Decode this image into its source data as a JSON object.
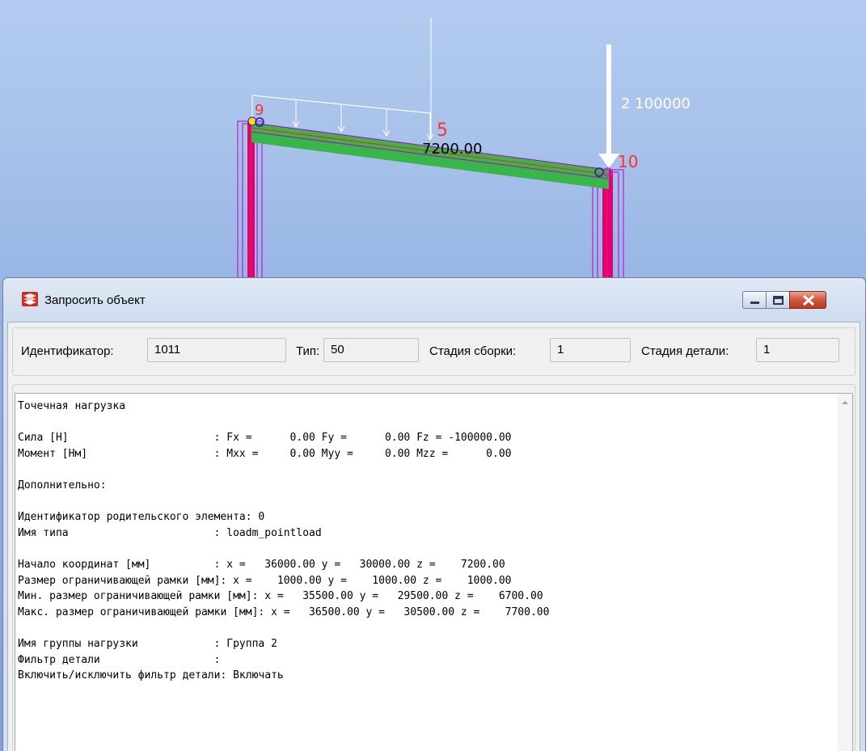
{
  "viewport": {
    "labels": {
      "node_9": "9",
      "node_5": "5",
      "node_10": "10",
      "dimension": "7200.00",
      "load": "2  100000"
    },
    "colors": {
      "background_top": "#b3cbef",
      "background_bottom": "#7f9fd8",
      "beam": "#3ab54a",
      "column": "#e0007a",
      "outline": "#b800d0",
      "load_arrow": "#ffffff",
      "label_red": "#ff3030"
    }
  },
  "dialog": {
    "title": "Запросить объект",
    "icon": "tekla-app-icon",
    "window_buttons": {
      "minimize": "minimize-icon",
      "maximize": "maximize-icon",
      "close": "close-icon"
    },
    "fields": {
      "id_label": "Идентификатор:",
      "id_value": "1011",
      "type_label": "Тип:",
      "type_value": "50",
      "assembly_stage_label": "Стадия сборки:",
      "assembly_stage_value": "1",
      "part_stage_label": "Стадия детали:",
      "part_stage_value": "1"
    },
    "report": "Точечная нагрузка\n\nСила [Н]                       : Fx =      0.00 Fy =      0.00 Fz = -100000.00\nМомент [Нм]                    : Mxx =     0.00 Myy =     0.00 Mzz =      0.00\n\nДополнительно:\n\nИдентификатор родительского элемента: 0\nИмя типа                       : loadm_pointload\n\nНачало координат [мм]          : x =   36000.00 y =   30000.00 z =    7200.00\nРазмер ограничивающей рамки [мм]: x =    1000.00 y =    1000.00 z =    1000.00\nМин. размер ограничивающей рамки [мм]: x =   35500.00 y =   29500.00 z =    6700.00\nМакс. размер ограничивающей рамки [мм]: x =   36500.00 y =   30500.00 z =    7700.00\n\nИмя группы нагрузки            : Группа 2\nФильтр детали                  :\nВключить/исключить фильтр детали: Включать",
    "scroll_up_icon": "scroll-up-arrow-icon"
  }
}
